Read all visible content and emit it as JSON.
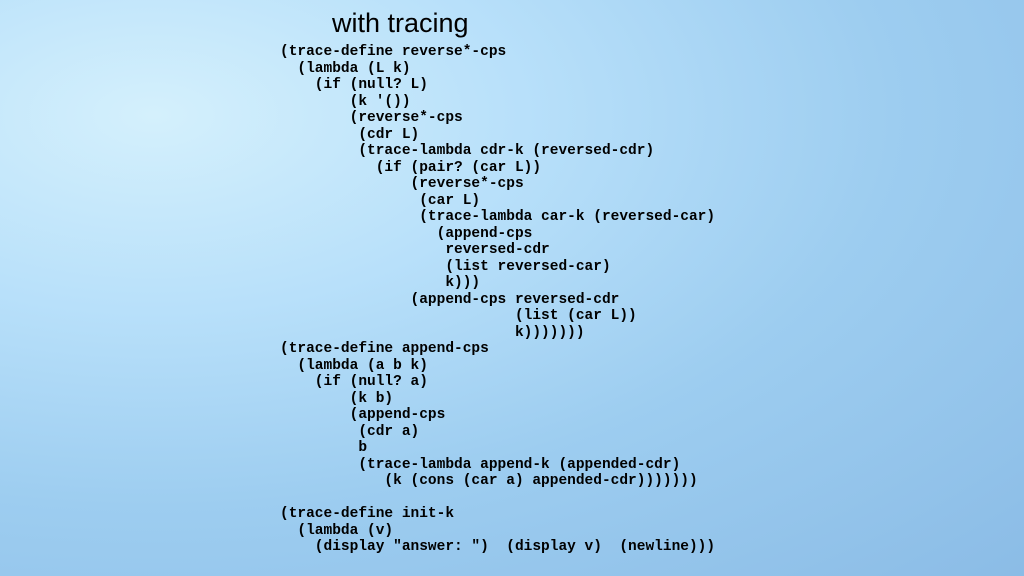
{
  "title": "with tracing",
  "code": "(trace-define reverse*-cps\n  (lambda (L k)\n    (if (null? L)\n        (k '())\n        (reverse*-cps\n         (cdr L)\n         (trace-lambda cdr-k (reversed-cdr)\n           (if (pair? (car L))\n               (reverse*-cps\n                (car L)\n                (trace-lambda car-k (reversed-car)\n                  (append-cps\n                   reversed-cdr\n                   (list reversed-car)\n                   k)))\n               (append-cps reversed-cdr\n                           (list (car L))\n                           k)))))))\n(trace-define append-cps\n  (lambda (a b k)\n    (if (null? a)\n        (k b)\n        (append-cps\n         (cdr a)\n         b\n         (trace-lambda append-k (appended-cdr)\n            (k (cons (car a) appended-cdr)))))))\n\n(trace-define init-k\n  (lambda (v)\n    (display \"answer: \")  (display v)  (newline)))"
}
